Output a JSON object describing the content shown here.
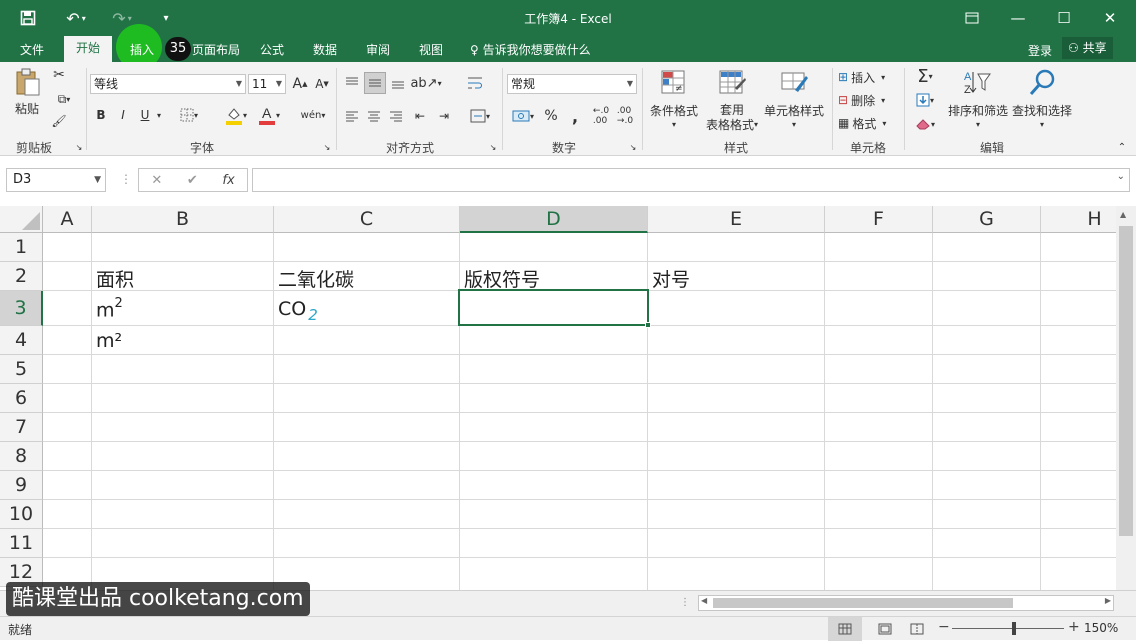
{
  "titlebar": {
    "title": "工作簿4 - Excel"
  },
  "tabs": [
    "文件",
    "开始",
    "插入",
    "页面布局",
    "公式",
    "数据",
    "审阅",
    "视图"
  ],
  "tellme": "告诉我你想要做什么",
  "account": {
    "login": "登录",
    "share": "共享"
  },
  "cursor": {
    "label": "插入",
    "badge": "35"
  },
  "ribbon": {
    "clipboard": {
      "paste": "粘贴",
      "group": "剪贴板"
    },
    "font": {
      "name": "等线",
      "size": "11",
      "bold": "B",
      "italic": "I",
      "underline": "U",
      "group": "字体"
    },
    "align": {
      "group": "对齐方式"
    },
    "number": {
      "format": "常规",
      "percent": "%",
      "group": "数字"
    },
    "styles": {
      "conditional": "条件格式",
      "table_line1": "套用",
      "table_line2": "表格格式",
      "cell": "单元格样式",
      "group": "样式"
    },
    "cells": {
      "insert": "插入",
      "delete": "删除",
      "format": "格式",
      "group": "单元格"
    },
    "editing": {
      "sort": "排序和筛选",
      "find": "查找和选择",
      "group": "编辑"
    }
  },
  "formula": {
    "namebox": "D3",
    "fx": "fx",
    "cancel": "✕",
    "enter": "✔"
  },
  "sheet": {
    "columns": [
      "A",
      "B",
      "C",
      "D",
      "E",
      "F",
      "G",
      "H"
    ],
    "rows": [
      "1",
      "2",
      "3",
      "4",
      "5",
      "6",
      "7",
      "8",
      "9",
      "10",
      "11",
      "12"
    ],
    "cells": {
      "B2": "面积",
      "C2": "二氧化碳",
      "D2": "版权符号",
      "E2": "对号",
      "B3_base": "m",
      "B3_sup": "2",
      "C3_base": "CO",
      "C3_sub": "2",
      "B4": "m²"
    }
  },
  "watermark": "酷课堂出品 coolketang.com",
  "status": {
    "ready": "就绪",
    "zoom": "150%"
  },
  "colors": {
    "excel_green": "#217346",
    "accent_sub": "#2aa7c9"
  }
}
